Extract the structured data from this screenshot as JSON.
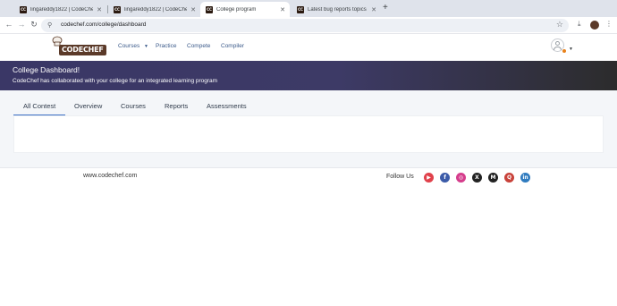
{
  "browser": {
    "tabs": [
      {
        "title": "lingareddy1822 | CodeChef Use",
        "favicon": "CC",
        "active": false
      },
      {
        "title": "lingareddy1822 | CodeChef Use",
        "favicon": "CC",
        "active": false
      },
      {
        "title": "College program",
        "favicon": "CC",
        "active": true
      },
      {
        "title": "Latest bug reports topics - Cod",
        "favicon": "CC",
        "active": false
      }
    ],
    "url": "codechef.com/college/dashboard",
    "icons": {
      "back": "arrow-left-icon",
      "forward": "arrow-right-icon",
      "reload": "reload-icon",
      "star": "star-icon",
      "download": "download-icon",
      "menu": "kebab-menu-icon"
    }
  },
  "header": {
    "logo_text": "CODECHEF",
    "nav": [
      {
        "label": "Courses",
        "has_dropdown": true
      },
      {
        "label": "Practice"
      },
      {
        "label": "Compete"
      },
      {
        "label": "Compiler"
      }
    ]
  },
  "banner": {
    "title": "College Dashboard!",
    "subtitle": "CodeChef has collaborated with your college for an integrated learning program",
    "colors": {
      "start": "#3a3766",
      "end": "#2c2c2c"
    }
  },
  "page_tabs": [
    {
      "label": "All Contest",
      "active": true
    },
    {
      "label": "Overview"
    },
    {
      "label": "Courses"
    },
    {
      "label": "Reports"
    },
    {
      "label": "Assessments"
    }
  ],
  "footer": {
    "site": "www.codechef.com",
    "follow_label": "Follow Us",
    "social": [
      {
        "name": "youtube-icon",
        "glyph": "▶",
        "color": "#e0414b"
      },
      {
        "name": "facebook-icon",
        "glyph": "f",
        "color": "#3b5ba8"
      },
      {
        "name": "instagram-icon",
        "glyph": "◎",
        "color": "#d53d8c"
      },
      {
        "name": "x-icon",
        "glyph": "X",
        "color": "#222222"
      },
      {
        "name": "medium-icon",
        "glyph": "M",
        "color": "#222222"
      },
      {
        "name": "quora-icon",
        "glyph": "Q",
        "color": "#c8423a"
      },
      {
        "name": "linkedin-icon",
        "glyph": "in",
        "color": "#2f7bbf"
      }
    ]
  }
}
